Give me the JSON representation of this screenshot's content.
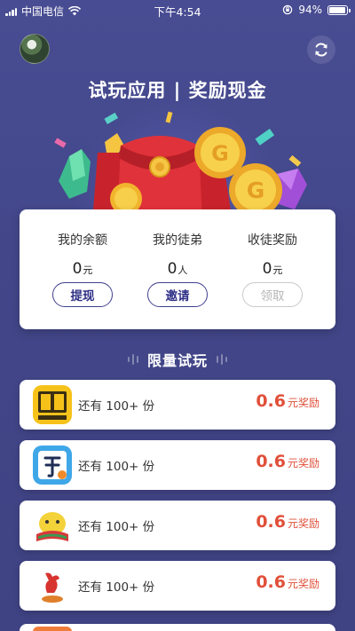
{
  "status_bar": {
    "carrier": "中国电信",
    "time": "下午4:54",
    "battery": "94%",
    "battery_level": 0.94
  },
  "header": {
    "title": "试玩应用 | 奖励现金"
  },
  "stats": [
    {
      "label": "我的余额",
      "value": "0",
      "unit": "元",
      "button": "提现",
      "button_enabled": true
    },
    {
      "label": "我的徒弟",
      "value": "0",
      "unit": "人",
      "button": "邀请",
      "button_enabled": true
    },
    {
      "label": "收徒奖励",
      "value": "0",
      "unit": "元",
      "button": "领取",
      "button_enabled": false
    }
  ],
  "section_title": "限量试玩",
  "apps": [
    {
      "icon": "yellow-app-icon",
      "remaining": "还有 100+ 份",
      "amount": "0.6",
      "unit": "元奖励"
    },
    {
      "icon": "dictionary-app-icon",
      "remaining": "还有 100+ 份",
      "amount": "0.6",
      "unit": "元奖励"
    },
    {
      "icon": "cartoon-character-app-icon",
      "remaining": "还有 100+ 份",
      "amount": "0.6",
      "unit": "元奖励"
    },
    {
      "icon": "360-app-icon",
      "remaining": "还有 100+ 份",
      "amount": "0.6",
      "unit": "元奖励"
    }
  ],
  "colors": {
    "background": "#464a8e",
    "accent": "#2e2f86",
    "reward": "#e0503a"
  }
}
